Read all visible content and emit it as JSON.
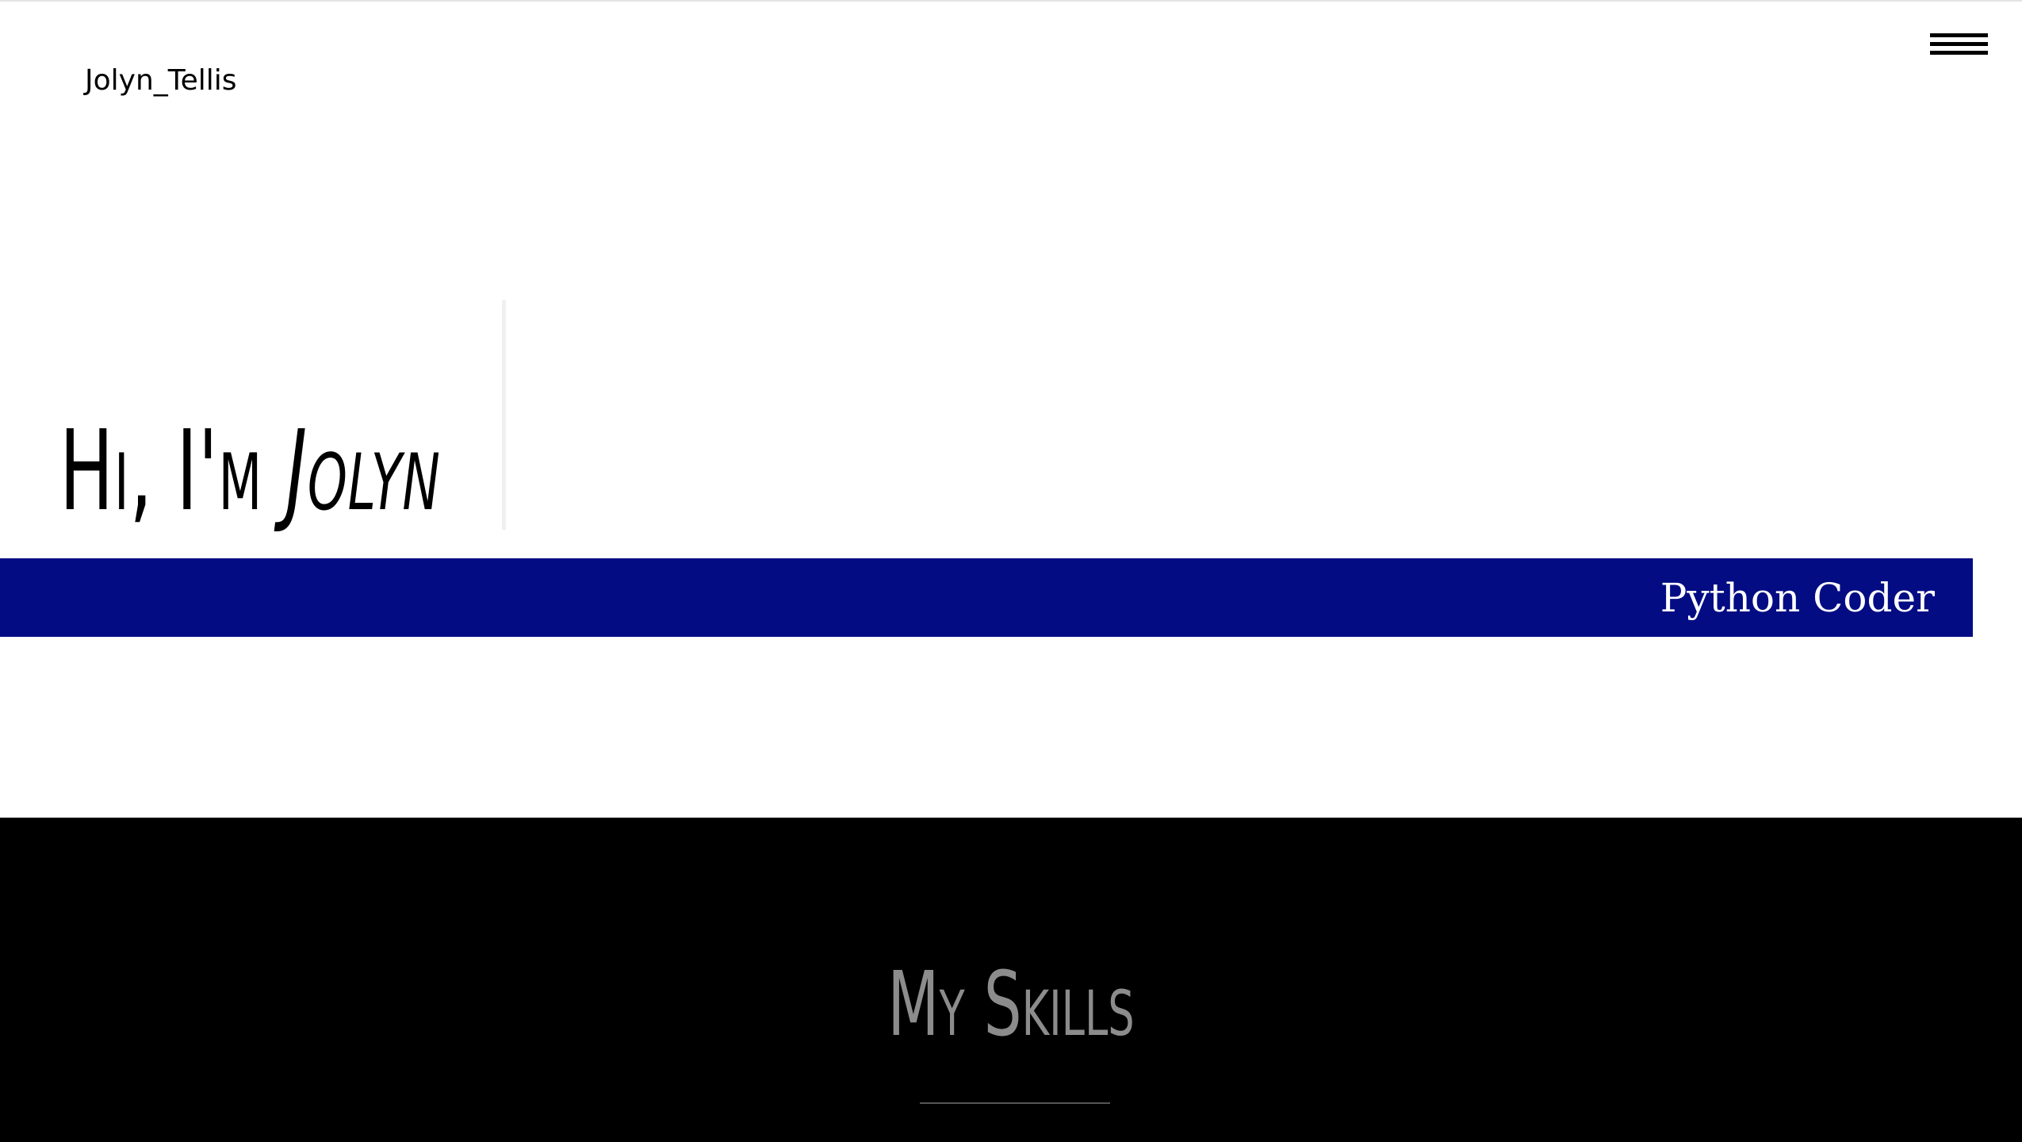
{
  "header": {
    "brand": "Jolyn_Tellis",
    "menu_icon": "hamburger-menu-icon"
  },
  "hero": {
    "greeting": "Hi, I'm ",
    "name": "Jolyn",
    "role": "Python Coder"
  },
  "skills": {
    "title": "My Skills"
  },
  "colors": {
    "role_bar": "#030c83",
    "skills_background": "#000000",
    "skills_title": "#8c8c8c"
  }
}
